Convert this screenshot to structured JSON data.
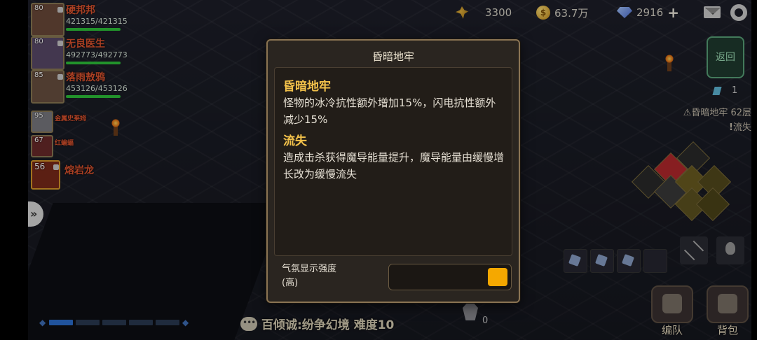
{
  "resources": [
    {
      "icon": "wheat-icon",
      "value": "3300"
    },
    {
      "icon": "gold-coin-icon",
      "value": "63.7万"
    },
    {
      "icon": "diamond-icon",
      "value": "2916"
    }
  ],
  "party": [
    {
      "level": "80",
      "name": "硬邦邦",
      "hp": "421315/421315",
      "hp_ratio": 1.0
    },
    {
      "level": "80",
      "name": "无良医生",
      "hp": "492773/492773",
      "hp_ratio": 1.0
    },
    {
      "level": "85",
      "name": "落雨敖鸦",
      "hp": "453126/453126",
      "hp_ratio": 1.0
    }
  ],
  "pets": [
    {
      "level": "95",
      "name": "金属史莱姆"
    },
    {
      "level": "67",
      "name": "红蝙蝠"
    },
    {
      "level": "56",
      "name": "熔岩龙"
    }
  ],
  "chat": {
    "text": "百倾诚:纷争幻境 难度10"
  },
  "right": {
    "back_label": "返回",
    "key_count": "1",
    "floor": "昏暗地牢 62层",
    "status": "流失"
  },
  "bottom": {
    "count": "0",
    "team_label": "编队",
    "bag_label": "背包"
  },
  "dialog": {
    "title": "昏暗地牢",
    "sections": [
      {
        "title": "昏暗地牢",
        "body": "怪物的冰冷抗性额外增加15%，闪电抗性额外减少15%"
      },
      {
        "title": "流失",
        "body": "造成击杀获得魔导能量提升，魔导能量由缓慢增长改为缓慢流失"
      }
    ],
    "option_label": "气氛显示强度\n(高)",
    "option_line1": "气氛显示强度",
    "option_line2": "(高)",
    "toggle_color": "#f5a800"
  }
}
